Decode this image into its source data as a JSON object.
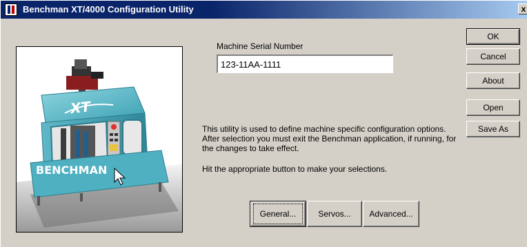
{
  "window": {
    "title": "Benchman XT/4000 Configuration Utility",
    "close_glyph": "x"
  },
  "serial": {
    "label": "Machine Serial Number",
    "value": "123-11AA-1111"
  },
  "description": "This utility is used to define machine specific configuration options. After selection you must exit the Benchman application, if running, for the changes to take effect.",
  "hint": "Hit the appropriate button  to make your selections.",
  "machine_image": {
    "logo_text": "XT",
    "brand_text": "BENCHMAN"
  },
  "side_buttons": {
    "ok": "OK",
    "cancel": "Cancel",
    "about": "About",
    "open": "Open",
    "save_as": "Save As"
  },
  "bottom_buttons": {
    "general": "General...",
    "servos": "Servos...",
    "advanced": "Advanced..."
  }
}
